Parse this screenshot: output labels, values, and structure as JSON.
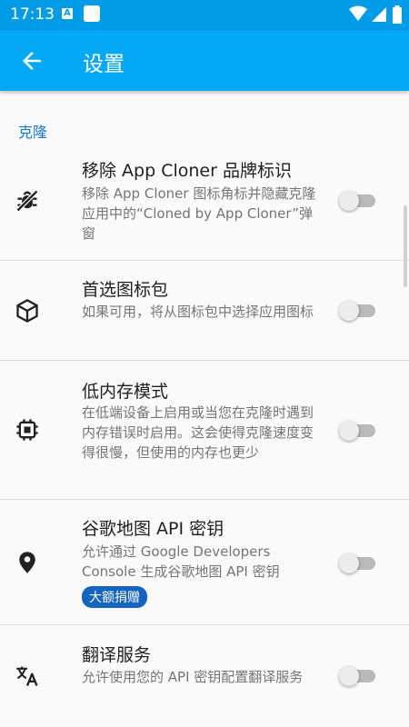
{
  "status_bar": {
    "time": "17:13",
    "notif_letter": "A"
  },
  "app_bar": {
    "title": "设置"
  },
  "section": {
    "title": "克隆"
  },
  "settings": [
    {
      "icon": "anti-bug-icon",
      "title": "移除 App Cloner 品牌标识",
      "summary": "移除 App Cloner 图标角标并隐藏克隆应用中的“Cloned by App Cloner”弹窗",
      "enabled": false
    },
    {
      "icon": "cube-icon",
      "title": "首选图标包",
      "summary": "如果可用，将从图标包中选择应用图标",
      "enabled": false
    },
    {
      "icon": "chip-icon",
      "title": "低内存模式",
      "summary": "在低端设备上启用或当您在克隆时遇到内存错误时启用。这会使得克隆速度变得很慢，但使用的内存也更少",
      "enabled": false
    },
    {
      "icon": "map-marker-icon",
      "title": "谷歌地图 API 密钥",
      "summary": "允许通过 Google Developers Console 生成谷歌地图 API 密钥",
      "badge": "大额捐赠",
      "enabled": false
    },
    {
      "icon": "translate-icon",
      "title": "翻译服务",
      "summary": "允许使用您的 API 密钥配置翻译服务",
      "enabled": false
    }
  ],
  "colors": {
    "status_bar": "#039be5",
    "app_bar": "#03a9f4",
    "section_header": "#1976d2",
    "badge": "#1565c0"
  }
}
